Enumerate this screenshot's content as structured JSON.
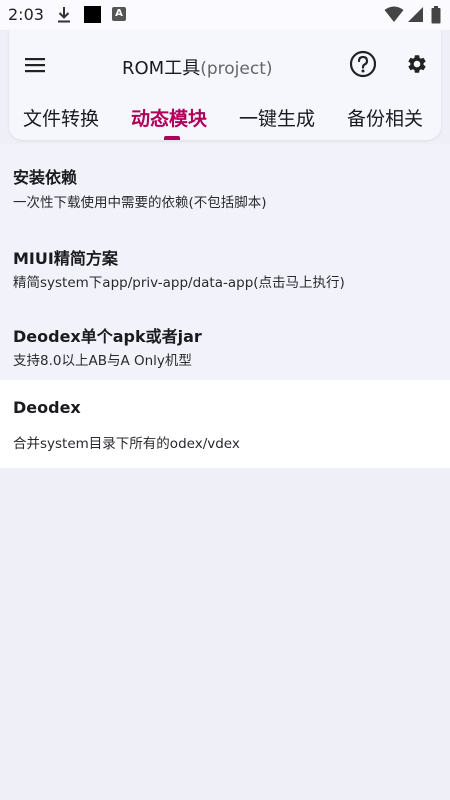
{
  "status_bar": {
    "time": "2:03",
    "icons": [
      "download-icon",
      "black-square-icon",
      "a-notification-icon",
      "wifi-icon",
      "signal-icon",
      "battery-icon"
    ]
  },
  "toolbar": {
    "title": "ROM工具",
    "subtitle": "(project)",
    "menu_icon": "menu-icon",
    "help_icon": "help-icon",
    "settings_icon": "gear-icon"
  },
  "tabs": [
    {
      "label": "文件转换",
      "active": false
    },
    {
      "label": "动态模块",
      "active": true
    },
    {
      "label": "一键生成",
      "active": false
    },
    {
      "label": "备份相关",
      "active": false
    }
  ],
  "items": [
    {
      "title": "安装依赖",
      "desc": "一次性下载使用中需要的依赖(不包括脚本)"
    },
    {
      "title": "MIUI精简方案",
      "desc": "精简system下app/priv-app/data-app(点击马上执行)"
    },
    {
      "title": "Deodex单个apk或者jar",
      "desc": "支持8.0以上AB与A Only机型"
    },
    {
      "title": "Deodex",
      "desc": "合并system目录下所有的odex/vdex"
    }
  ],
  "colors": {
    "accent": "#b1005a",
    "background": "#eff0f7",
    "card": "#f6f7fd"
  }
}
